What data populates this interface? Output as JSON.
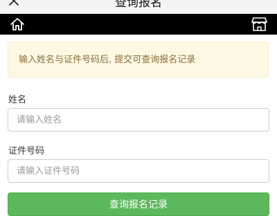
{
  "header": {
    "title": "查询报名",
    "close_icon": "close-icon"
  },
  "navbar": {
    "home_icon": "home-icon",
    "store_icon": "store-icon",
    "background": "#000000"
  },
  "notice": {
    "text": "输入姓名与证件号码后, 提交可查询报名记录"
  },
  "form": {
    "name_label": "姓名",
    "name_placeholder": "请输入姓名",
    "id_label": "证件号码",
    "id_placeholder": "请输入证件号码",
    "submit_label": "查询报名记录"
  },
  "colors": {
    "notice_bg": "#fcf8e3",
    "notice_text": "#8a6d3b",
    "button": "#5cb85c"
  }
}
